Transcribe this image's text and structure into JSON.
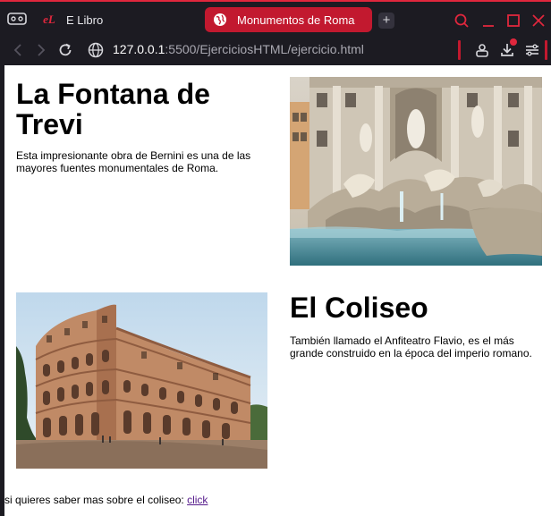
{
  "browser": {
    "tabs": [
      {
        "label": "E Libro",
        "favicon": "eL",
        "active": false
      },
      {
        "label": "Monumentos de Roma",
        "active": true
      }
    ],
    "new_tab_symbol": "+",
    "url_host": "127.0.0.1",
    "url_rest": ":5500/EjerciciosHTML/ejercicio.html",
    "accent_color": "#e0273d",
    "active_tab_color": "#c2192f"
  },
  "page": {
    "sections": [
      {
        "title": "La Fontana de Trevi",
        "description": "Esta impresionante obra de Bernini es una de las mayores fuentes monumentales de Roma.",
        "image": "trevi-fountain-photo"
      },
      {
        "title": "El Coliseo",
        "description": "También llamado el Anfiteatro Flavio, es el más grande construido en la época del imperio romano.",
        "image": "colosseum-photo"
      }
    ],
    "footer_text": "si quieres saber mas sobre el coliseo: ",
    "footer_link": "click"
  }
}
